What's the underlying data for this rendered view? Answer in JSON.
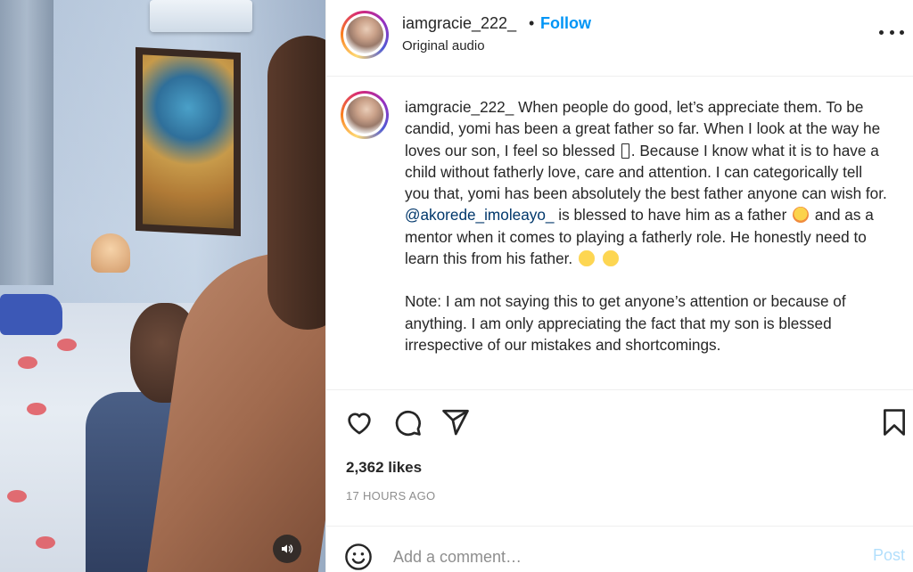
{
  "post": {
    "username": "iamgracie_222_",
    "separator": "•",
    "follow_label": "Follow",
    "audio_label": "Original audio",
    "caption": {
      "username": "iamgracie_222_",
      "part1": "When people do good, let’s appreciate them. To be candid, yomi has been a great father so far. When I look at the way he loves our son, I feel so blessed",
      "part2": ". Because I know what it is to have a child without fatherly love, care and attention. I can categorically tell you that, yomi has been absolutely the best father anyone can wish for.",
      "mention": "@akorede_imoleayo_",
      "part3": "is blessed to have him as a father",
      "part4": "and as a mentor when it comes to playing a fatherly role. He honestly need to learn this from his father.",
      "note": "Note: I am not saying this to get anyone’s attention or because of anything. I am only appreciating the fact that my son is blessed irrespective of our mistakes and shortcomings."
    },
    "likes": "2,362 likes",
    "time_ago": "17 HOURS AGO"
  },
  "comment": {
    "placeholder": "Add a comment…",
    "post_label": "Post"
  },
  "icons": {
    "like": "heart-icon",
    "comment": "comment-icon",
    "share": "paper-plane-icon",
    "save": "bookmark-icon",
    "more": "more-options-icon",
    "emoji": "smiley-icon",
    "mute": "speaker-icon"
  },
  "colors": {
    "follow": "#0095f6",
    "mention": "#00376b",
    "muted_text": "#8e8e8e",
    "post_disabled": "#b2dffc"
  }
}
